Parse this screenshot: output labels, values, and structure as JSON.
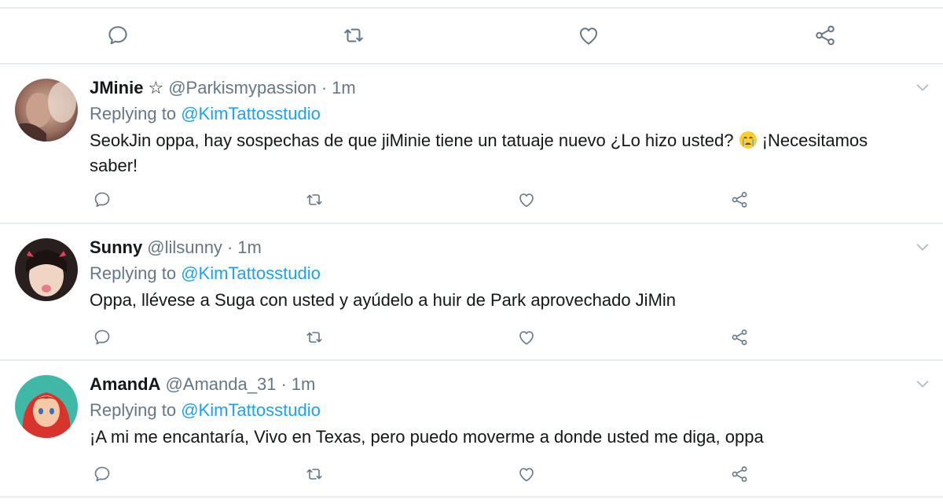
{
  "colors": {
    "accent": "#1da1f2",
    "secondary_text": "#657786",
    "primary_text": "#14171a",
    "divider": "#e6ecf0"
  },
  "top_actions": {
    "icons": [
      "reply-icon",
      "retweet-icon",
      "like-icon",
      "share-icon"
    ]
  },
  "tweets": [
    {
      "name": "JMinie",
      "badge": "☆",
      "handle": "@Parkismypassion",
      "separator": "·",
      "time": "1m",
      "replying_prefix": "Replying to",
      "replying_to": "@KimTattosstudio",
      "text_before_emoji": "SeokJin oppa, hay sospechas de que jiMinie tiene un tatuaje nuevo ¿Lo hizo usted? ",
      "emoji": "crying-face-icon",
      "text_after_emoji": " ¡Necesitamos saber!"
    },
    {
      "name": "Sunny",
      "handle": "@lilsunny",
      "separator": "·",
      "time": "1m",
      "replying_prefix": "Replying to",
      "replying_to": "@KimTattosstudio",
      "text": "Oppa, llévese a Suga con usted y ayúdelo a huir de Park aprovechado JiMin"
    },
    {
      "name": "AmandA",
      "handle": "@Amanda_31",
      "separator": "·",
      "time": "1m",
      "replying_prefix": "Replying to",
      "replying_to": "@KimTattosstudio",
      "text": "¡A mi me encantaría, Vivo en Texas, pero puedo moverme a donde usted me diga, oppa"
    }
  ]
}
